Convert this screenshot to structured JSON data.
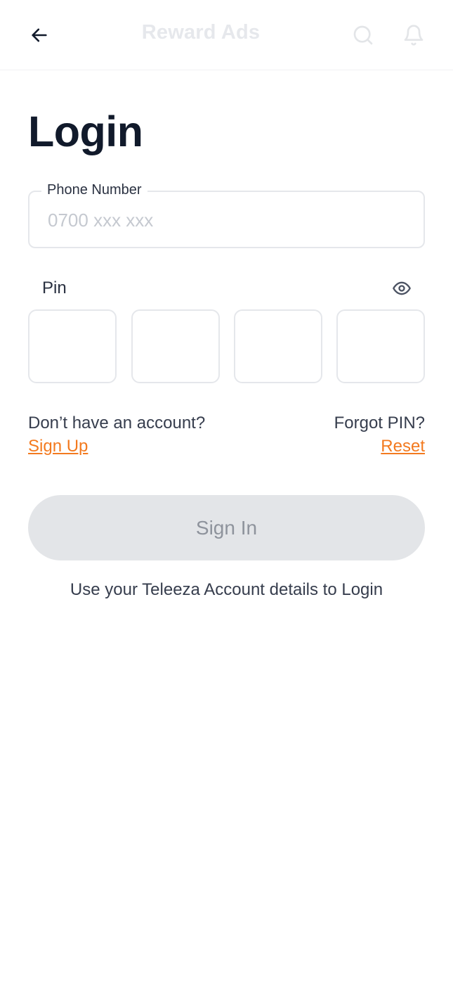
{
  "header": {
    "title": "Reward Ads",
    "back_icon": "arrow-left-icon",
    "search_icon": "search-icon",
    "notification_icon": "bell-icon"
  },
  "page": {
    "title": "Login"
  },
  "phone": {
    "label": "Phone Number",
    "placeholder": "0700 xxx xxx",
    "value": ""
  },
  "pin": {
    "label": "Pin",
    "toggle_icon": "eye-icon",
    "digits": [
      "",
      "",
      "",
      ""
    ]
  },
  "links": {
    "no_account_text": "Don’t have an account?",
    "signup_label": "Sign Up",
    "forgot_text": "Forgot PIN?",
    "reset_label": "Reset"
  },
  "actions": {
    "signin_label": "Sign In"
  },
  "helper": {
    "text": "Use your Teleeza Account details to Login"
  },
  "colors": {
    "accent": "#f37a1f",
    "title": "#111a2b",
    "disabled_button_bg": "#e3e5e8",
    "disabled_button_text": "#8e939c",
    "border": "#e5e7eb"
  }
}
